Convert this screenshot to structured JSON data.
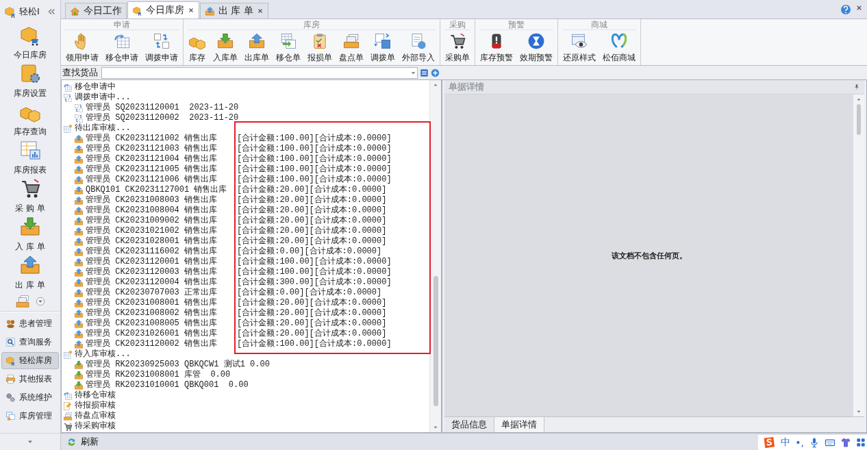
{
  "sidebar": {
    "title": "轻松I",
    "shortcuts": [
      "今日库房",
      "库房设置",
      "库存查询",
      "库房报表",
      "采 购 单",
      "入 库 单",
      "出 库 单"
    ],
    "nav": [
      {
        "label": "患者管理",
        "selected": false
      },
      {
        "label": "查询服务",
        "selected": false
      },
      {
        "label": "轻松库房",
        "selected": true
      },
      {
        "label": "其他报表",
        "selected": false
      },
      {
        "label": "系统维护",
        "selected": false
      },
      {
        "label": "库房管理",
        "selected": false
      }
    ]
  },
  "tabs": [
    {
      "label": "今日工作",
      "selected": false,
      "closable": false
    },
    {
      "label": "今日库房",
      "selected": true,
      "closable": true
    },
    {
      "label": "出 库 单",
      "selected": false,
      "closable": true
    }
  ],
  "ribbon": [
    {
      "title": "申请",
      "buttons": [
        "领用申请",
        "移仓申请",
        "调拨申请"
      ]
    },
    {
      "title": "库房",
      "buttons": [
        "库存",
        "入库单",
        "出库单",
        "移仓单",
        "报损单",
        "盘点单",
        "调拨单",
        "外部导入"
      ]
    },
    {
      "title": "采购",
      "buttons": [
        "采购单"
      ]
    },
    {
      "title": "预警",
      "buttons": [
        "库存预警",
        "效期预警"
      ]
    },
    {
      "title": "商城",
      "buttons": [
        "还原样式",
        "松佰商城"
      ]
    }
  ],
  "search": {
    "label": "查找货品"
  },
  "tree": [
    {
      "label": "移仓申请中",
      "kind": "move"
    },
    {
      "label": "调拨申请中...",
      "kind": "allocation",
      "children": [
        {
          "kind": "allocation",
          "text": "管理员 SQ20231120001  2023-11-20"
        },
        {
          "kind": "allocation",
          "text": "管理员 SQ20231120002  2023-11-20"
        }
      ]
    },
    {
      "label": "待出库审核...",
      "kind": "review",
      "children": [
        {
          "kind": "outbound",
          "text": "管理员 CK20231121002 销售出库",
          "amount": "[合计金额:100.00][合计成本:0.0000]"
        },
        {
          "kind": "outbound",
          "text": "管理员 CK20231121003 销售出库",
          "amount": "[合计金额:100.00][合计成本:0.0000]"
        },
        {
          "kind": "outbound",
          "text": "管理员 CK20231121004 销售出库",
          "amount": "[合计金额:100.00][合计成本:0.0000]"
        },
        {
          "kind": "outbound",
          "text": "管理员 CK20231121005 销售出库",
          "amount": "[合计金额:100.00][合计成本:0.0000]"
        },
        {
          "kind": "outbound",
          "text": "管理员 CK20231121006 销售出库",
          "amount": "[合计金额:100.00][合计成本:0.0000]"
        },
        {
          "kind": "outbound",
          "text": "QBKQ101 CK20231127001 销售出库",
          "amount": "[合计金额:20.00][合计成本:0.0000]"
        },
        {
          "kind": "outbound",
          "text": "管理员 CK20231008003 销售出库",
          "amount": "[合计金额:20.00][合计成本:0.0000]"
        },
        {
          "kind": "outbound",
          "text": "管理员 CK20231008004 销售出库",
          "amount": "[合计金额:20.00][合计成本:0.0000]"
        },
        {
          "kind": "outbound",
          "text": "管理员 CK20231009002 销售出库",
          "amount": "[合计金额:20.00][合计成本:0.0000]"
        },
        {
          "kind": "outbound",
          "text": "管理员 CK20231021002 销售出库",
          "amount": "[合计金额:20.00][合计成本:0.0000]"
        },
        {
          "kind": "outbound",
          "text": "管理员 CK20231028001 销售出库",
          "amount": "[合计金额:20.00][合计成本:0.0000]"
        },
        {
          "kind": "outbound",
          "text": "管理员 CK20231116002 销售出库",
          "amount": "[合计金额:0.00][合计成本:0.0000]"
        },
        {
          "kind": "outbound",
          "text": "管理员 CK20231120001 销售出库",
          "amount": "[合计金额:100.00][合计成本:0.0000]"
        },
        {
          "kind": "outbound",
          "text": "管理员 CK20231120003 销售出库",
          "amount": "[合计金额:100.00][合计成本:0.0000]"
        },
        {
          "kind": "outbound",
          "text": "管理员 CK20231120004 销售出库",
          "amount": "[合计金额:300.00][合计成本:0.0000]"
        },
        {
          "kind": "outbound",
          "text": "管理员 CK20230707003 正常出库",
          "amount": "[合计金额:0.00][合计成本:0.0000]"
        },
        {
          "kind": "outbound",
          "text": "管理员 CK20231008001 销售出库",
          "amount": "[合计金额:20.00][合计成本:0.0000]"
        },
        {
          "kind": "outbound",
          "text": "管理员 CK20231008002 销售出库",
          "amount": "[合计金额:20.00][合计成本:0.0000]"
        },
        {
          "kind": "outbound",
          "text": "管理员 CK20231008005 销售出库",
          "amount": "[合计金额:20.00][合计成本:0.0000]"
        },
        {
          "kind": "outbound",
          "text": "管理员 CK20231026001 销售出库",
          "amount": "[合计金额:20.00][合计成本:0.0000]"
        },
        {
          "kind": "outbound",
          "text": "管理员 CK20231120002 销售出库",
          "amount": "[合计金额:100.00][合计成本:0.0000]"
        }
      ]
    },
    {
      "label": "待入库审核...",
      "kind": "review",
      "children": [
        {
          "kind": "inbound",
          "text": "管理员 RK20230925003 QBKQCW1 测试1 0.00"
        },
        {
          "kind": "inbound",
          "text": "管理员 RK20231008001 库管  0.00"
        },
        {
          "kind": "inbound",
          "text": "管理员 RK20231010001 QBKQ001  0.00"
        }
      ]
    },
    {
      "label": "待移仓审核",
      "kind": "move"
    },
    {
      "label": "待报损审核",
      "kind": "loss"
    },
    {
      "label": "待盘点审核",
      "kind": "stocktake"
    },
    {
      "label": "待采购审核",
      "kind": "purchase"
    }
  ],
  "detail": {
    "title": "单据详情",
    "message": "该文档不包含任何页。",
    "tabs": [
      {
        "label": "货品信息",
        "selected": false
      },
      {
        "label": "单据详情",
        "selected": true
      }
    ]
  },
  "status_bar": {
    "button": "刷新"
  },
  "ime": {
    "mode": "中",
    "punctuation": "•,"
  }
}
